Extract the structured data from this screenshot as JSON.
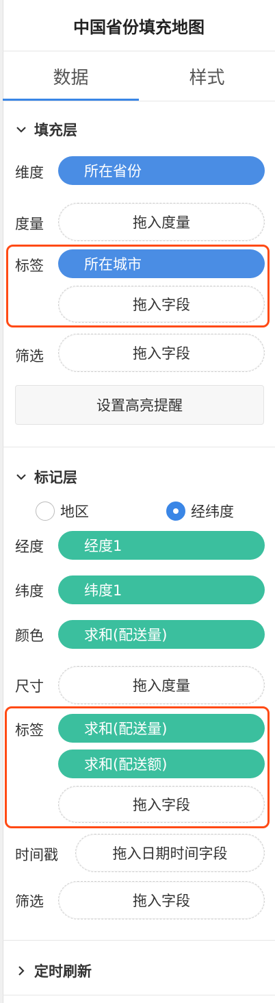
{
  "title": "中国省份填充地图",
  "tabs": {
    "data": "数据",
    "style": "样式"
  },
  "fill_layer": {
    "header": "填充层",
    "dimension": {
      "label": "维度",
      "value": "所在省份"
    },
    "measure": {
      "label": "度量",
      "placeholder": "拖入度量"
    },
    "tag": {
      "label": "标签",
      "value": "所在城市",
      "placeholder": "拖入字段"
    },
    "filter": {
      "label": "筛选",
      "placeholder": "拖入字段"
    },
    "highlight_button": "设置高亮提醒"
  },
  "marker_layer": {
    "header": "标记层",
    "radio_region": "地区",
    "radio_latlng": "经纬度",
    "longitude": {
      "label": "经度",
      "value": "经度1"
    },
    "latitude": {
      "label": "纬度",
      "value": "纬度1"
    },
    "color": {
      "label": "颜色",
      "value": "求和(配送量)"
    },
    "size": {
      "label": "尺寸",
      "placeholder": "拖入度量"
    },
    "tag": {
      "label": "标签",
      "value1": "求和(配送量)",
      "value2": "求和(配送额)",
      "placeholder": "拖入字段"
    },
    "timestamp": {
      "label": "时间戳",
      "placeholder": "拖入日期时间字段"
    },
    "filter": {
      "label": "筛选",
      "placeholder": "拖入字段"
    }
  },
  "timer": {
    "header": "定时刷新"
  },
  "colors": {
    "blue_pill": "#4a8de4",
    "green_pill": "#3bbf9e",
    "highlight_border": "#ff4a14",
    "active_tab": "#3a86e6"
  }
}
